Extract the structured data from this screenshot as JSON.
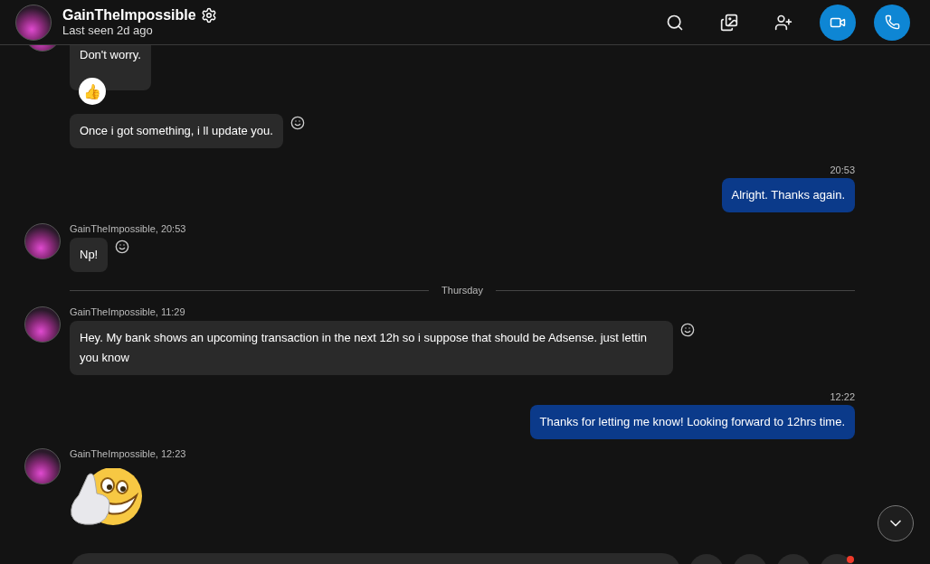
{
  "header": {
    "name": "GainTheImpossible",
    "status": "Last seen 2d ago"
  },
  "messages": [
    {
      "kind": "incoming",
      "text": "Don't worry.",
      "reaction": "👍",
      "smiley": false
    },
    {
      "kind": "incoming",
      "text": "Once i got something, i ll update you.",
      "smiley": true
    },
    {
      "kind": "outgoing",
      "time": "20:53",
      "text": "Alright. Thanks again."
    },
    {
      "kind": "incoming",
      "meta": "GainTheImpossible, 20:53",
      "text": "Np!",
      "smiley": true
    },
    {
      "kind": "divider",
      "text": "Thursday"
    },
    {
      "kind": "incoming",
      "meta": "GainTheImpossible, 11:29",
      "text": "Hey. My bank shows an upcoming transaction in the next 12h so i suppose that should be Adsense. just lettin you know",
      "smiley": true
    },
    {
      "kind": "outgoing",
      "time": "12:22",
      "text": "Thanks for letting me know! Looking forward to 12hrs time."
    },
    {
      "kind": "emoji",
      "meta": "GainTheImpossible, 12:23"
    }
  ],
  "composer": {
    "notification": true
  }
}
